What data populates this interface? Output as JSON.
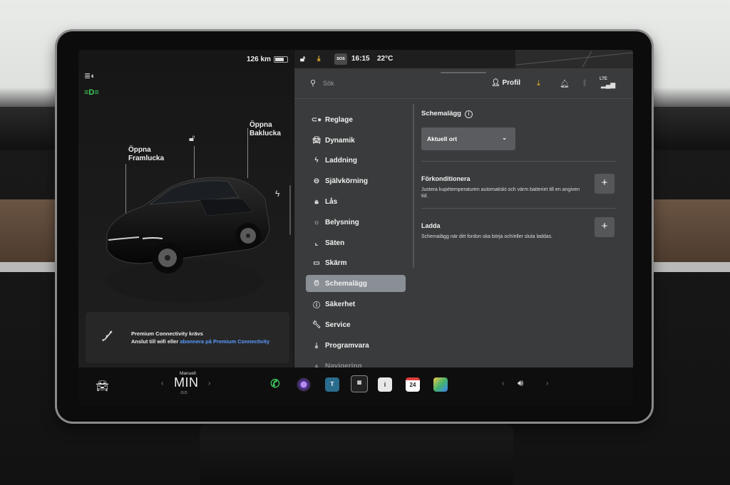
{
  "status": {
    "range": "126 km",
    "time": "16:15",
    "temperature": "22°C",
    "sos": "SOS"
  },
  "car_panel": {
    "frunk_label_line1": "Öppna",
    "frunk_label_line2": "Framlucka",
    "trunk_label_line1": "Öppna",
    "trunk_label_line2": "Baklucka",
    "notice_title": "Premium Connectivity krävs",
    "notice_text_prefix": "Anslut till wifi eller ",
    "notice_link": "abonnera på Premium Connectivity"
  },
  "topbar": {
    "search_placeholder": "Sök",
    "profile_label": "Profil",
    "network_label": "LTE"
  },
  "menu": {
    "items": [
      {
        "label": "Reglage",
        "icon": "toggle-icon"
      },
      {
        "label": "Dynamik",
        "icon": "car-icon"
      },
      {
        "label": "Laddning",
        "icon": "bolt-icon"
      },
      {
        "label": "Självkörning",
        "icon": "steering-wheel-icon"
      },
      {
        "label": "Lås",
        "icon": "lock-icon"
      },
      {
        "label": "Belysning",
        "icon": "sun-icon"
      },
      {
        "label": "Säten",
        "icon": "seat-icon"
      },
      {
        "label": "Skärm",
        "icon": "screen-icon"
      },
      {
        "label": "Schemalägg",
        "icon": "alarm-clock-icon"
      },
      {
        "label": "Säkerhet",
        "icon": "info-circle-icon"
      },
      {
        "label": "Service",
        "icon": "wrench-icon"
      },
      {
        "label": "Programvara",
        "icon": "download-icon"
      },
      {
        "label": "Navigering",
        "icon": "navigation-arrow-icon"
      }
    ],
    "active": "Schemalägg"
  },
  "content": {
    "title": "Schemalägg",
    "dropdown_value": "Aktuell ort",
    "precondition_title": "Förkonditionera",
    "precondition_desc": "Justera kupétemperaturen automatiskt och värm batteriet till en angiven tid.",
    "charge_title": "Ladda",
    "charge_desc": "Schemalägg när ditt fordon ska börja och/eller sluta laddas."
  },
  "dock": {
    "hvac_mode": "Manuell",
    "hvac_value": "MIN",
    "calendar_day": "24"
  },
  "colors": {
    "accent_link": "#5a9bff",
    "active_menu": "#8a8f96",
    "phone_green": "#3ec25c",
    "download_yellow": "#f5b82e"
  }
}
